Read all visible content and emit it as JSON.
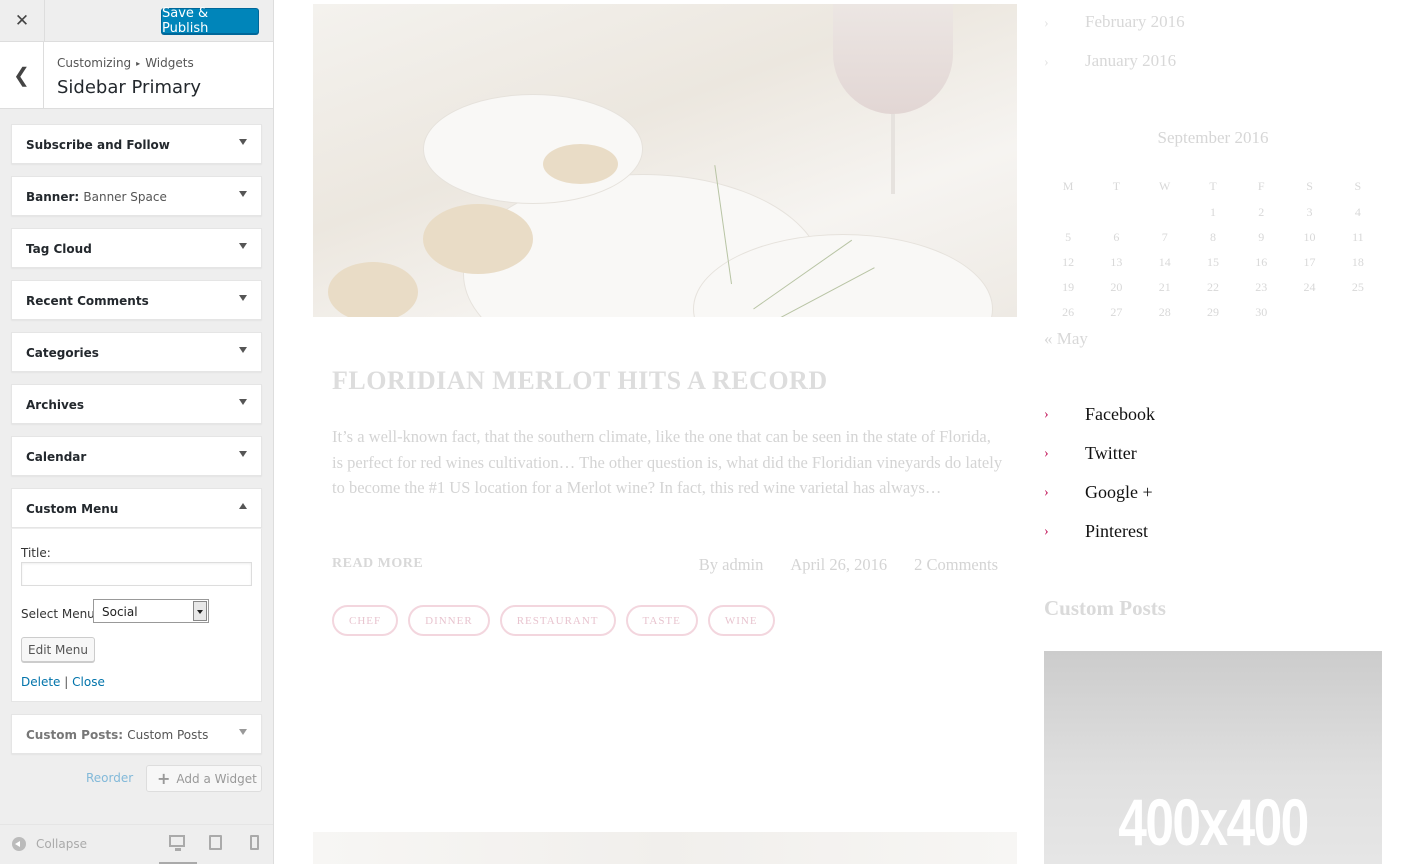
{
  "customizer": {
    "header": {
      "close_icon": "close-icon",
      "publish_label": "Save & Publish",
      "publish_color": "#0085ba"
    },
    "breadcrumb": {
      "parent": "Customizing",
      "separator": "▸",
      "section": "Widgets"
    },
    "section_title": "Sidebar Primary",
    "widgets": [
      {
        "title": "Subscribe and Follow",
        "subtitle": "",
        "expanded": false
      },
      {
        "title": "Banner:",
        "subtitle": "Banner Space",
        "expanded": false
      },
      {
        "title": "Tag Cloud",
        "subtitle": "",
        "expanded": false
      },
      {
        "title": "Recent Comments",
        "subtitle": "",
        "expanded": false
      },
      {
        "title": "Categories",
        "subtitle": "",
        "expanded": false
      },
      {
        "title": "Archives",
        "subtitle": "",
        "expanded": false
      },
      {
        "title": "Calendar",
        "subtitle": "",
        "expanded": false
      },
      {
        "title": "Custom Menu",
        "subtitle": "",
        "expanded": true
      },
      {
        "title": "Custom Posts:",
        "subtitle": "Custom Posts",
        "expanded": false
      }
    ],
    "custom_menu_form": {
      "title_label": "Title:",
      "title_value": "",
      "select_label": "Select Menu:",
      "select_value": "Social",
      "edit_button": "Edit Menu",
      "delete_link": "Delete",
      "link_separator": "|",
      "close_link": "Close"
    },
    "reorder_label": "Reorder",
    "add_widget_label": "Add a Widget",
    "footer": {
      "collapse_label": "Collapse",
      "active_device": "desktop"
    }
  },
  "preview": {
    "post": {
      "title": "FLORIDIAN MERLOT HITS A RECORD",
      "excerpt": "It’s a well-known fact, that the southern climate, like the one that can be seen in the state of Florida, is perfect for red wines cultivation… The other question is, what did the Floridian vineyards do lately to become the #1 US location for a Merlot wine? In fact, this red wine varietal has always…",
      "read_more": "READ MORE",
      "author": "By admin",
      "date": "April 26, 2016",
      "comments": "2 Comments",
      "tags": [
        "CHEF",
        "DINNER",
        "RESTAURANT",
        "TASTE",
        "WINE"
      ]
    },
    "archives": [
      "February 2016",
      "January 2016"
    ],
    "calendar": {
      "caption": "September 2016",
      "weekdays": [
        "M",
        "T",
        "W",
        "T",
        "F",
        "S",
        "S"
      ],
      "weeks": [
        [
          "",
          "",
          "",
          "1",
          "2",
          "3",
          "4"
        ],
        [
          "5",
          "6",
          "7",
          "8",
          "9",
          "10",
          "11"
        ],
        [
          "12",
          "13",
          "14",
          "15",
          "16",
          "17",
          "18"
        ],
        [
          "19",
          "20",
          "21",
          "22",
          "23",
          "24",
          "25"
        ],
        [
          "26",
          "27",
          "28",
          "29",
          "30",
          "",
          ""
        ]
      ],
      "prev_link": "« May"
    },
    "social_menu": [
      "Facebook",
      "Twitter",
      "Google +",
      "Pinterest"
    ],
    "custom_posts_heading": "Custom Posts",
    "placeholder_text": "400x400",
    "accent_color": "#c2185b"
  }
}
